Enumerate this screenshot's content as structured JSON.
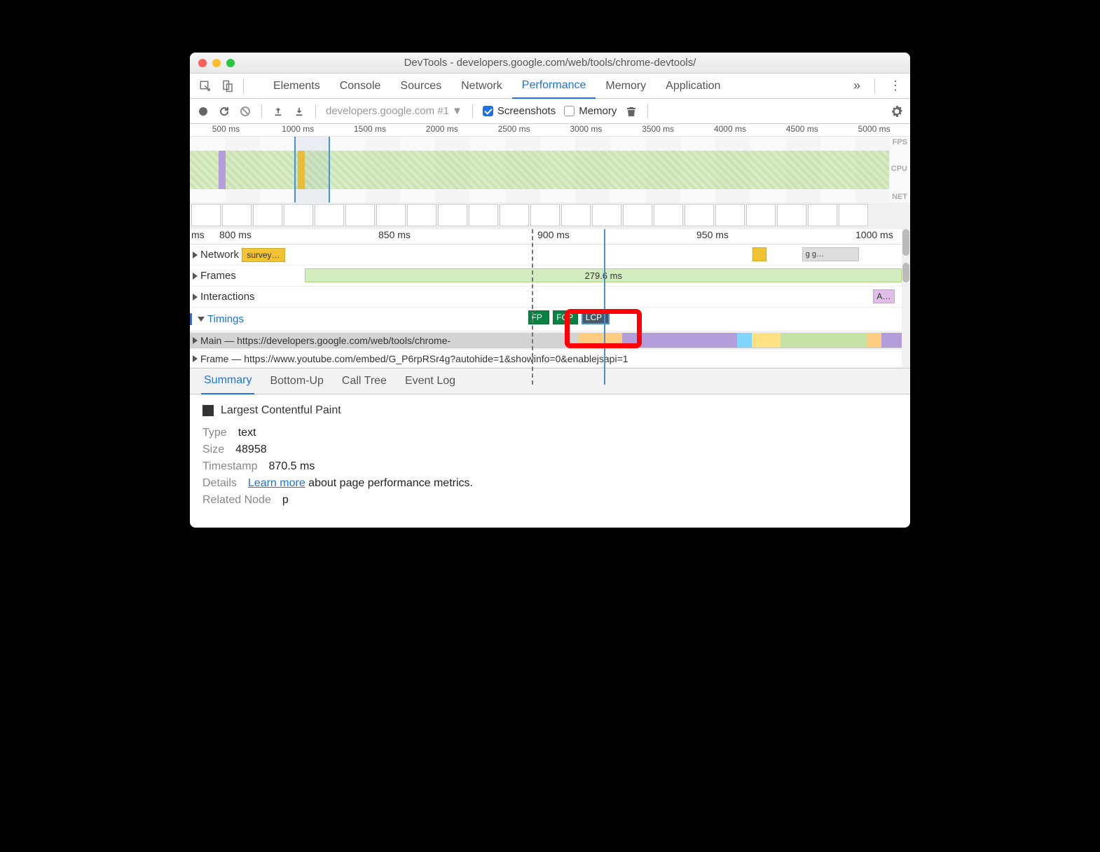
{
  "window": {
    "title": "DevTools - developers.google.com/web/tools/chrome-devtools/"
  },
  "tabs": {
    "items": [
      "Elements",
      "Console",
      "Sources",
      "Network",
      "Performance",
      "Memory",
      "Application"
    ],
    "active": "Performance"
  },
  "toolbar": {
    "dropdown": "developers.google.com #1",
    "screenshots_label": "Screenshots",
    "memory_label": "Memory"
  },
  "overview": {
    "ticks": [
      "500 ms",
      "1000 ms",
      "1500 ms",
      "2000 ms",
      "2500 ms",
      "3000 ms",
      "3500 ms",
      "4000 ms",
      "4500 ms",
      "5000 ms"
    ],
    "labels": {
      "fps": "FPS",
      "cpu": "CPU",
      "net": "NET"
    }
  },
  "detail": {
    "ticks": [
      "ms",
      "800 ms",
      "850 ms",
      "900 ms",
      "950 ms",
      "1000 ms"
    ],
    "rows": {
      "network": "Network",
      "network_truncated": "survey…",
      "frames": "Frames",
      "frame_duration": "279.6 ms",
      "interactions": "Interactions",
      "interactions_item": "A…",
      "timings": "Timings",
      "main": "Main — https://developers.google.com/web/tools/chrome-",
      "frame": "Frame — https://www.youtube.com/embed/G_P6rpRSr4g?autohide=1&showinfo=0&enablejsapi=1",
      "fp": "FP",
      "fcp": "FCP",
      "lcp": "LCP",
      "gg": "g g…"
    }
  },
  "bottom_tabs": [
    "Summary",
    "Bottom-Up",
    "Call Tree",
    "Event Log"
  ],
  "summary": {
    "heading": "Largest Contentful Paint",
    "type_label": "Type",
    "type_value": "text",
    "size_label": "Size",
    "size_value": "48958",
    "timestamp_label": "Timestamp",
    "timestamp_value": "870.5 ms",
    "details_label": "Details",
    "learn_more": "Learn more",
    "details_tail": " about page performance metrics.",
    "related_label": "Related Node",
    "related_value": "p"
  }
}
